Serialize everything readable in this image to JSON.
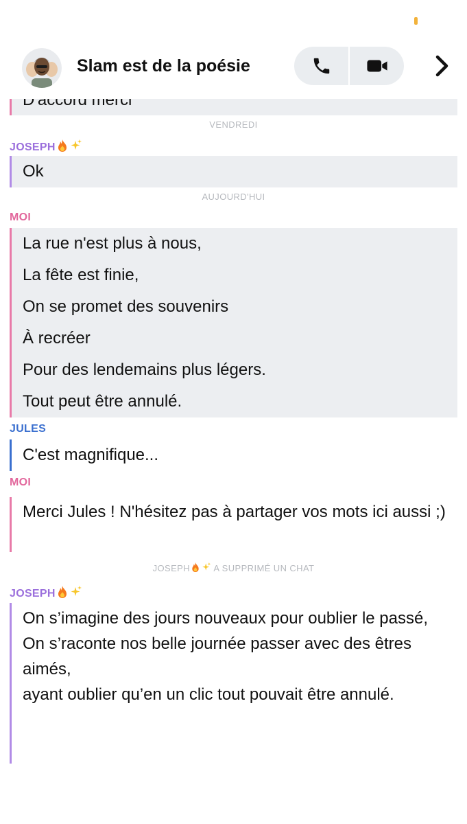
{
  "header": {
    "title": "Slam est de la poésie",
    "avatar_icon": "bitmoji-avatar",
    "voice_call_icon": "phone-icon",
    "video_call_icon": "video-camera-icon",
    "next_icon": "chevron-right-icon"
  },
  "colors": {
    "joseph": "#9b6fdc",
    "moi": "#e2679c",
    "jules": "#3a6fcf",
    "bubble_bg": "#eceef1",
    "separator": "#b6b9be"
  },
  "chat": {
    "partial_message": "D'accord merci",
    "sep_friday": "VENDREDI",
    "sender_joseph_1": "JOSEPH",
    "msg_ok": "Ok",
    "sep_today": "AUJOURD'HUI",
    "sender_moi_1": "MOI",
    "poem_lines": [
      "La rue n'est plus à nous,",
      "La fête est finie,",
      "On se promet des souvenirs",
      "À recréer",
      "Pour des lendemains plus légers.",
      "Tout peut être annulé."
    ],
    "sender_jules": "JULES",
    "msg_jules": "C'est magnifique...",
    "sender_moi_2": "MOI",
    "msg_moi_2": "Merci Jules ! N'hésitez pas à partager vos mots ici aussi ;)",
    "deleted_prefix": "JOSEPH",
    "deleted_suffix": "A SUPPRIMÉ UN CHAT",
    "sender_joseph_2": "JOSEPH",
    "joseph_lines": [
      "On s’imagine des jours nouveaux pour oublier le passé,",
      "On s’raconte nos belle journée passer avec des êtres aimés,",
      "ayant oublier qu’en un clic tout pouvait être annulé."
    ]
  }
}
